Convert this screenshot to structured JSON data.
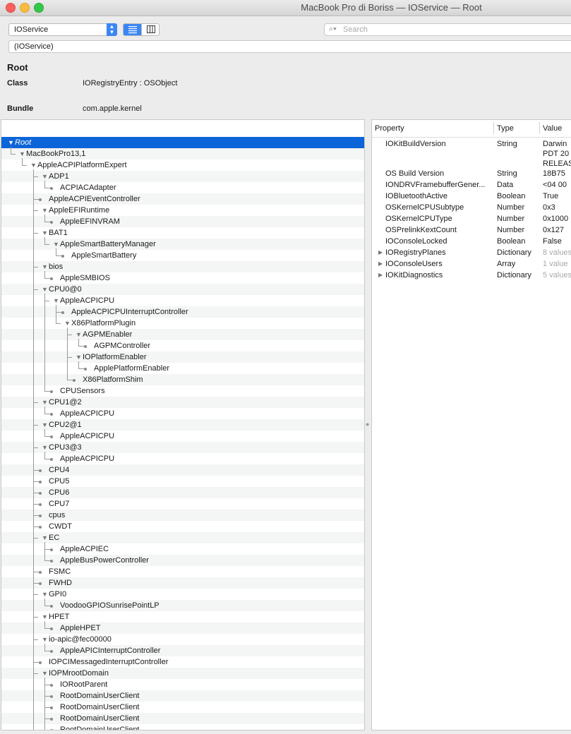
{
  "window": {
    "title": "MacBook Pro di Boriss — IOService — Root"
  },
  "toolbar": {
    "plane": "IOService",
    "search_placeholder": "Search",
    "path": "(IOService)"
  },
  "info": {
    "title": "Root",
    "class_label": "Class",
    "class_value": "IORegistryEntry : OSObject",
    "bundle_label": "Bundle",
    "bundle_value": "com.apple.kernel"
  },
  "tree": [
    {
      "depth": 0,
      "label": "Root",
      "exp": true,
      "sel": true
    },
    {
      "depth": 1,
      "label": "MacBookPro13,1",
      "exp": true
    },
    {
      "depth": 2,
      "label": "AppleACPIPlatformExpert",
      "exp": true
    },
    {
      "depth": 3,
      "label": "ADP1",
      "exp": true
    },
    {
      "depth": 4,
      "label": "ACPIACAdapter"
    },
    {
      "depth": 3,
      "label": "AppleACPIEventController"
    },
    {
      "depth": 3,
      "label": "AppleEFIRuntime",
      "exp": true
    },
    {
      "depth": 4,
      "label": "AppleEFINVRAM"
    },
    {
      "depth": 3,
      "label": "BAT1",
      "exp": true
    },
    {
      "depth": 4,
      "label": "AppleSmartBatteryManager",
      "exp": true
    },
    {
      "depth": 5,
      "label": "AppleSmartBattery"
    },
    {
      "depth": 3,
      "label": "bios",
      "exp": true
    },
    {
      "depth": 4,
      "label": "AppleSMBIOS"
    },
    {
      "depth": 3,
      "label": "CPU0@0",
      "exp": true
    },
    {
      "depth": 4,
      "label": "AppleACPICPU",
      "exp": true
    },
    {
      "depth": 5,
      "label": "AppleACPICPUInterruptController"
    },
    {
      "depth": 5,
      "label": "X86PlatformPlugin",
      "exp": true
    },
    {
      "depth": 6,
      "label": "AGPMEnabler",
      "exp": true
    },
    {
      "depth": 7,
      "label": "AGPMController"
    },
    {
      "depth": 6,
      "label": "IOPlatformEnabler",
      "exp": true
    },
    {
      "depth": 7,
      "label": "ApplePlatformEnabler"
    },
    {
      "depth": 6,
      "label": "X86PlatformShim"
    },
    {
      "depth": 4,
      "label": "CPUSensors"
    },
    {
      "depth": 3,
      "label": "CPU1@2",
      "exp": true
    },
    {
      "depth": 4,
      "label": "AppleACPICPU"
    },
    {
      "depth": 3,
      "label": "CPU2@1",
      "exp": true
    },
    {
      "depth": 4,
      "label": "AppleACPICPU"
    },
    {
      "depth": 3,
      "label": "CPU3@3",
      "exp": true
    },
    {
      "depth": 4,
      "label": "AppleACPICPU"
    },
    {
      "depth": 3,
      "label": "CPU4"
    },
    {
      "depth": 3,
      "label": "CPU5"
    },
    {
      "depth": 3,
      "label": "CPU6"
    },
    {
      "depth": 3,
      "label": "CPU7"
    },
    {
      "depth": 3,
      "label": "cpus"
    },
    {
      "depth": 3,
      "label": "CWDT"
    },
    {
      "depth": 3,
      "label": "EC",
      "exp": true
    },
    {
      "depth": 4,
      "label": "AppleACPIEC"
    },
    {
      "depth": 4,
      "label": "AppleBusPowerController"
    },
    {
      "depth": 3,
      "label": "FSMC"
    },
    {
      "depth": 3,
      "label": "FWHD"
    },
    {
      "depth": 3,
      "label": "GPI0",
      "exp": true
    },
    {
      "depth": 4,
      "label": "VoodooGPIOSunrisePointLP"
    },
    {
      "depth": 3,
      "label": "HPET",
      "exp": true
    },
    {
      "depth": 4,
      "label": "AppleHPET"
    },
    {
      "depth": 3,
      "label": "io-apic@fec00000",
      "exp": true
    },
    {
      "depth": 4,
      "label": "AppleAPICInterruptController"
    },
    {
      "depth": 3,
      "label": "IOPCIMessagedInterruptController"
    },
    {
      "depth": 3,
      "label": "IOPMrootDomain",
      "exp": true
    },
    {
      "depth": 4,
      "label": "IORootParent"
    },
    {
      "depth": 4,
      "label": "RootDomainUserClient"
    },
    {
      "depth": 4,
      "label": "RootDomainUserClient"
    },
    {
      "depth": 4,
      "label": "RootDomainUserClient"
    },
    {
      "depth": 4,
      "label": "RootDomainUserClient"
    }
  ],
  "props": {
    "headers": [
      "Property",
      "Type",
      "Value"
    ],
    "rows": [
      {
        "name": "IOKitBuildVersion",
        "type": "String",
        "value": [
          "Darwin",
          "PDT 20",
          "RELEAS"
        ]
      },
      {
        "name": "OS Build Version",
        "type": "String",
        "value": [
          "18B75"
        ]
      },
      {
        "name": "IONDRVFramebufferGener...",
        "type": "Data",
        "value": [
          "<04 00"
        ]
      },
      {
        "name": "IOBluetoothActive",
        "type": "Boolean",
        "value": [
          "True"
        ]
      },
      {
        "name": "OSKernelCPUSubtype",
        "type": "Number",
        "value": [
          "0x3"
        ]
      },
      {
        "name": "OSKernelCPUType",
        "type": "Number",
        "value": [
          "0x1000"
        ]
      },
      {
        "name": "OSPrelinkKextCount",
        "type": "Number",
        "value": [
          "0x127"
        ]
      },
      {
        "name": "IOConsoleLocked",
        "type": "Boolean",
        "value": [
          "False"
        ]
      },
      {
        "name": "IORegistryPlanes",
        "type": "Dictionary",
        "value": [
          "8 values"
        ],
        "disc": true,
        "grey": true
      },
      {
        "name": "IOConsoleUsers",
        "type": "Array",
        "value": [
          "1 value"
        ],
        "disc": true,
        "grey": true
      },
      {
        "name": "IOKitDiagnostics",
        "type": "Dictionary",
        "value": [
          "5 values"
        ],
        "disc": true,
        "grey": true
      }
    ]
  },
  "colors": {
    "selection": "#0b64d8",
    "accent": "#3b86f4"
  }
}
